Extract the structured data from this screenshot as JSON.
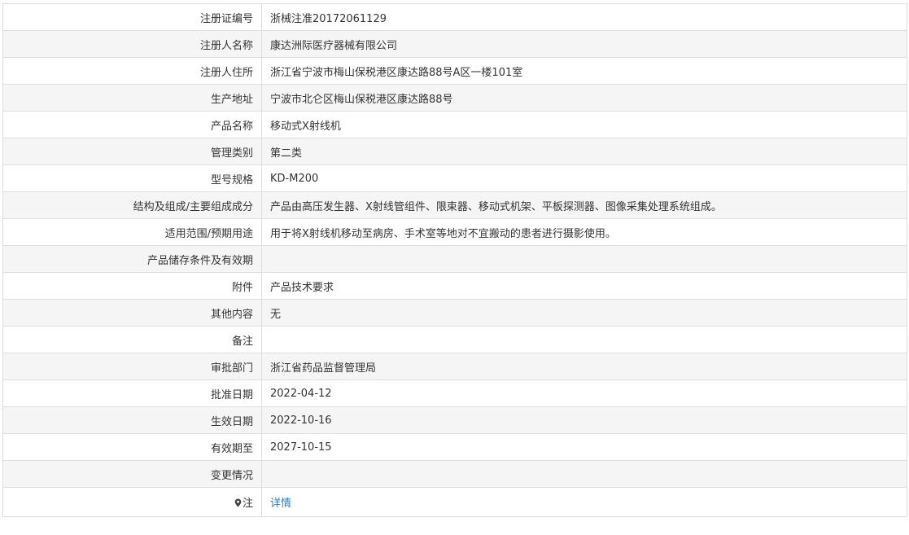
{
  "rows": [
    {
      "label": "注册证编号",
      "value": "浙械注准20172061129"
    },
    {
      "label": "注册人名称",
      "value": "康达洲际医疗器械有限公司"
    },
    {
      "label": "注册人住所",
      "value": "浙江省宁波市梅山保税港区康达路88号A区一楼101室"
    },
    {
      "label": "生产地址",
      "value": "宁波市北仑区梅山保税港区康达路88号"
    },
    {
      "label": "产品名称",
      "value": "移动式X射线机"
    },
    {
      "label": "管理类别",
      "value": "第二类"
    },
    {
      "label": "型号规格",
      "value": "KD-M200"
    },
    {
      "label": "结构及组成/主要组成成分",
      "value": "产品由高压发生器、X射线管组件、限束器、移动式机架、平板探测器、图像采集处理系统组成。"
    },
    {
      "label": "适用范围/预期用途",
      "value": "用于将X射线机移动至病房、手术室等地对不宜搬动的患者进行摄影使用。"
    },
    {
      "label": "产品储存条件及有效期",
      "value": ""
    },
    {
      "label": "附件",
      "value": "产品技术要求"
    },
    {
      "label": "其他内容",
      "value": "无"
    },
    {
      "label": "备注",
      "value": ""
    },
    {
      "label": "审批部门",
      "value": "浙江省药品监督管理局"
    },
    {
      "label": "批准日期",
      "value": "2022-04-12"
    },
    {
      "label": "生效日期",
      "value": "2022-10-16"
    },
    {
      "label": "有效期至",
      "value": "2027-10-15"
    },
    {
      "label": "变更情况",
      "value": ""
    }
  ],
  "note": {
    "icon": "map-marker-icon",
    "label": "注",
    "link_text": "详情"
  },
  "colors": {
    "border": "#dddddd",
    "stripe": "#f5f5f5",
    "text": "#333333",
    "link": "#2a7bc0"
  }
}
